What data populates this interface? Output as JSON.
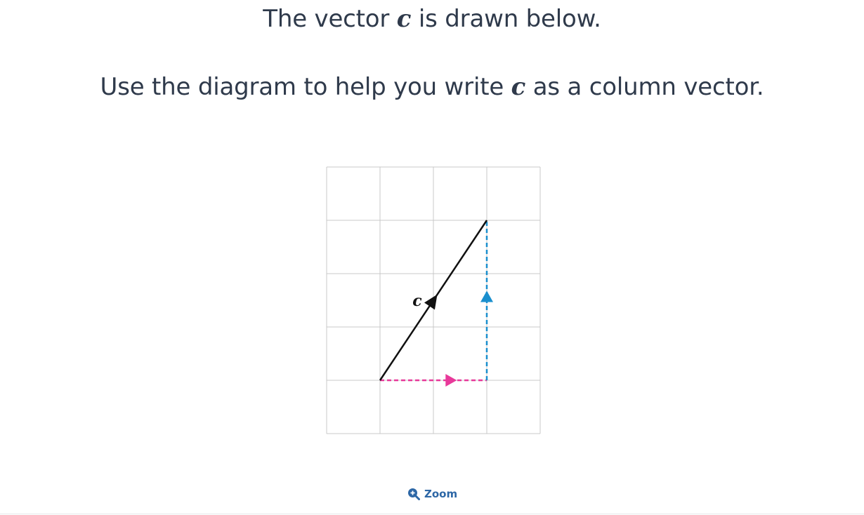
{
  "question": {
    "line1_before": "The vector ",
    "line1_vector": "c",
    "line1_after": " is drawn below.",
    "line2_before": "Use the diagram to help you write ",
    "line2_vector": "c",
    "line2_after": " as a column vector."
  },
  "diagram": {
    "grid_columns": 4,
    "grid_rows": 5,
    "vector_label": "c",
    "vector_components": {
      "x": 2,
      "y": 3
    },
    "colors": {
      "grid": "#c8c8c8",
      "vector": "#111111",
      "horizontal_component": "#e8399a",
      "vertical_component": "#1a8fce"
    }
  },
  "zoom": {
    "label": "Zoom",
    "icon": "zoom-in-icon"
  }
}
